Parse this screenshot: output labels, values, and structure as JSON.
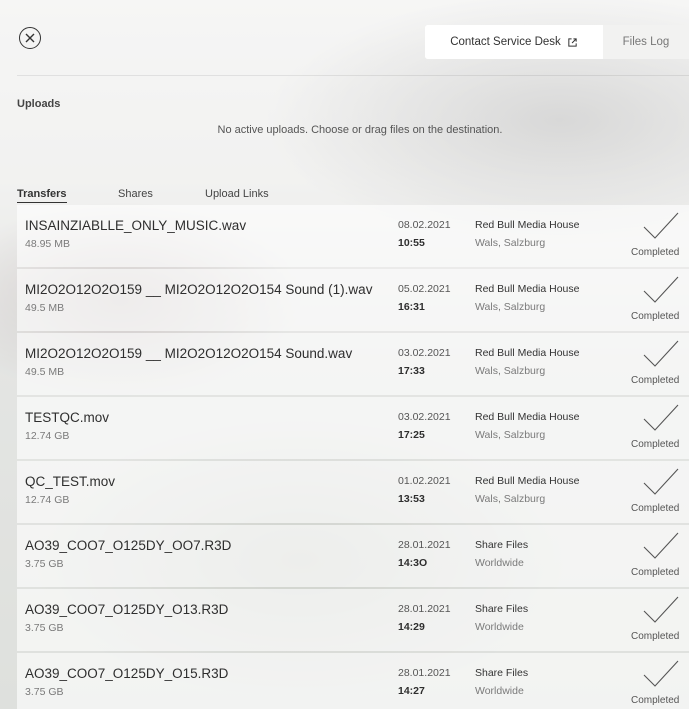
{
  "header": {
    "close_icon": "close-circle-icon",
    "contact_label": "Contact Service Desk",
    "contact_icon": "external-link-icon",
    "files_log_label": "Files Log"
  },
  "uploads": {
    "heading": "Uploads",
    "empty_message": "No active uploads. Choose or drag files on the destination."
  },
  "tabs": [
    {
      "label": "Transfers",
      "active": true
    },
    {
      "label": "Shares",
      "active": false
    },
    {
      "label": "Upload Links",
      "active": false
    }
  ],
  "transfers": [
    {
      "name": "INSAINZIABLLE_ONLY_MUSIC.wav",
      "size": "48.95 MB",
      "date": "08.02.2021",
      "time": "10:55",
      "org": "Red Bull Media House",
      "location": "Wals, Salzburg",
      "status": "Completed"
    },
    {
      "name": "MI2O2O12O2O159 __ MI2O2O12O2O154 Sound (1).wav",
      "size": "49.5 MB",
      "date": "05.02.2021",
      "time": "16:31",
      "org": "Red Bull Media House",
      "location": "Wals, Salzburg",
      "status": "Completed"
    },
    {
      "name": "MI2O2O12O2O159 __ MI2O2O12O2O154 Sound.wav",
      "size": "49.5 MB",
      "date": "03.02.2021",
      "time": "17:33",
      "org": "Red Bull Media House",
      "location": "Wals, Salzburg",
      "status": "Completed"
    },
    {
      "name": "TESTQC.mov",
      "size": "12.74 GB",
      "date": "03.02.2021",
      "time": "17:25",
      "org": "Red Bull Media House",
      "location": "Wals, Salzburg",
      "status": "Completed"
    },
    {
      "name": "QC_TEST.mov",
      "size": "12.74 GB",
      "date": "01.02.2021",
      "time": "13:53",
      "org": "Red Bull Media House",
      "location": "Wals, Salzburg",
      "status": "Completed"
    },
    {
      "name": "AO39_COO7_O125DY_OO7.R3D",
      "size": "3.75 GB",
      "date": "28.01.2021",
      "time": "14:3O",
      "org": "Share Files",
      "location": "Worldwide",
      "status": "Completed"
    },
    {
      "name": "AO39_COO7_O125DY_O13.R3D",
      "size": "3.75 GB",
      "date": "28.01.2021",
      "time": "14:29",
      "org": "Share Files",
      "location": "Worldwide",
      "status": "Completed"
    },
    {
      "name": "AO39_COO7_O125DY_O15.R3D",
      "size": "3.75 GB",
      "date": "28.01.2021",
      "time": "14:27",
      "org": "Share Files",
      "location": "Worldwide",
      "status": "Completed"
    }
  ]
}
